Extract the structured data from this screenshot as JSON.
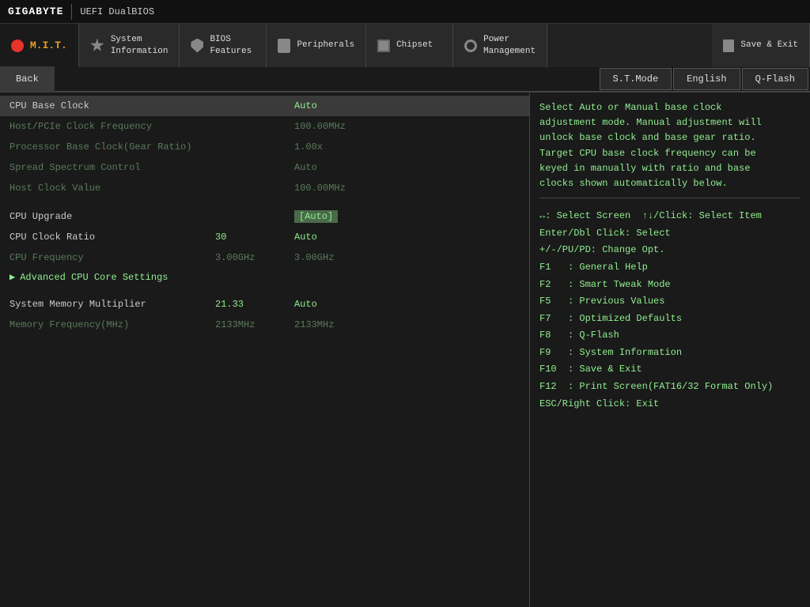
{
  "topbar": {
    "logo": "GIGABYTE",
    "uefi": "UEFI DualBIOS"
  },
  "nav": {
    "mit_label": "M.I.T.",
    "tabs": [
      {
        "id": "system-info",
        "line1": "System",
        "line2": "Information"
      },
      {
        "id": "bios-features",
        "line1": "BIOS",
        "line2": "Features"
      },
      {
        "id": "peripherals",
        "line1": "",
        "line2": "Peripherals"
      },
      {
        "id": "chipset",
        "line1": "",
        "line2": "Chipset"
      },
      {
        "id": "power-mgmt",
        "line1": "Power",
        "line2": "Management"
      },
      {
        "id": "save-exit",
        "line1": "",
        "line2": "Save & Exit"
      }
    ]
  },
  "subnav": {
    "back_label": "Back",
    "stmode_label": "S.T.Mode",
    "english_label": "English",
    "qflash_label": "Q-Flash"
  },
  "settings": {
    "rows": [
      {
        "id": "cpu-base-clock",
        "name": "CPU Base Clock",
        "col2": "",
        "value": "Auto",
        "style": "selected"
      },
      {
        "id": "host-pcie",
        "name": "Host/PCIe Clock Frequency",
        "col2": "",
        "value": "100.00MHz",
        "style": "dim"
      },
      {
        "id": "proc-base-clock",
        "name": "Processor Base Clock(Gear Ratio)",
        "col2": "",
        "value": "1.00x",
        "style": "dim"
      },
      {
        "id": "spread-spectrum",
        "name": "Spread Spectrum Control",
        "col2": "",
        "value": "Auto",
        "style": "dim"
      },
      {
        "id": "host-clock-val",
        "name": "Host Clock Value",
        "col2": "",
        "value": "100.00MHz",
        "style": "dim"
      },
      {
        "id": "gap1",
        "type": "gap"
      },
      {
        "id": "cpu-upgrade",
        "name": "CPU Upgrade",
        "col2": "",
        "value": "[Auto]",
        "style": "normal",
        "value_style": "selected-val"
      },
      {
        "id": "cpu-clock-ratio",
        "name": "CPU Clock Ratio",
        "col2": "30",
        "value": "Auto",
        "style": "normal"
      },
      {
        "id": "cpu-freq",
        "name": "CPU Frequency",
        "col2": "3.00GHz",
        "value": "3.00GHz",
        "style": "dim"
      },
      {
        "id": "adv-cpu-core",
        "name": "▶  Advanced CPU Core Settings",
        "col2": "",
        "value": "",
        "style": "arrow"
      },
      {
        "id": "gap2",
        "type": "gap"
      },
      {
        "id": "sys-mem-mult",
        "name": "System Memory Multiplier",
        "col2": "21.33",
        "value": "Auto",
        "style": "normal"
      },
      {
        "id": "mem-freq",
        "name": "Memory Frequency(MHz)",
        "col2": "2133MHz",
        "value": "2133MHz",
        "style": "dim"
      }
    ]
  },
  "help": {
    "text": "Select Auto or Manual base clock\nadjustment mode. Manual adjustment will\nunlock base clock and base gear ratio.\nTarget CPU base clock frequency can be\nkeyed in manually with ratio and base\nclocks shown automatically below."
  },
  "hotkeys": {
    "lines": [
      "↔: Select Screen  ↑↓/Click: Select Item",
      "Enter/Dbl Click: Select",
      "+/-/PU/PD: Change Opt.",
      "F1   : General Help",
      "F2   : Smart Tweak Mode",
      "F5   : Previous Values",
      "F7   : Optimized Defaults",
      "F8   : Q-Flash",
      "F9   : System Information",
      "F10  : Save & Exit",
      "F12  : Print Screen(FAT16/32 Format Only)",
      "ESC/Right Click: Exit"
    ]
  }
}
